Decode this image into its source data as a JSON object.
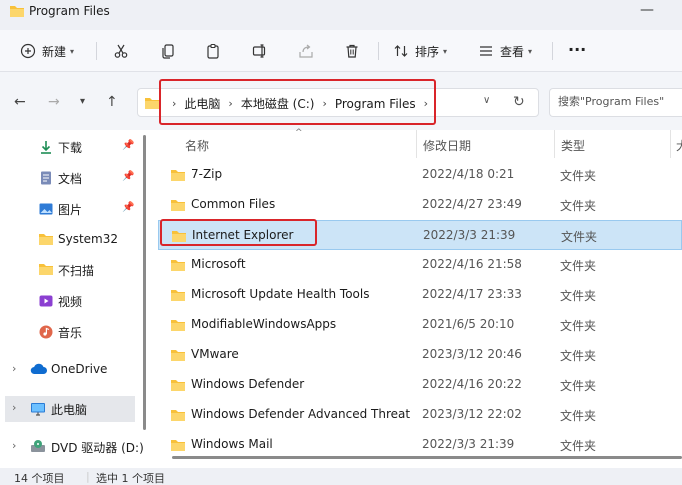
{
  "window": {
    "title": "Program Files"
  },
  "toolbar": {
    "new_label": "新建",
    "sort_label": "排序",
    "view_label": "查看",
    "more": "···"
  },
  "address": {
    "crumbs": [
      "此电脑",
      "本地磁盘 (C:)",
      "Program Files"
    ],
    "search_placeholder": "搜索\"Program Files\""
  },
  "sidebar": {
    "items": [
      {
        "label": "下载",
        "icon": "download-icon"
      },
      {
        "label": "文档",
        "icon": "document-icon"
      },
      {
        "label": "图片",
        "icon": "pictures-icon"
      },
      {
        "label": "System32",
        "icon": "folder-icon"
      },
      {
        "label": "不扫描",
        "icon": "folder-icon"
      },
      {
        "label": "视频",
        "icon": "video-icon"
      },
      {
        "label": "音乐",
        "icon": "music-icon"
      },
      {
        "label": "OneDrive",
        "icon": "cloud-icon"
      },
      {
        "label": "此电脑",
        "icon": "monitor-icon"
      },
      {
        "label": "DVD 驱动器 (D:)",
        "icon": "dvd-icon"
      }
    ]
  },
  "columns": {
    "name": "名称",
    "date": "修改日期",
    "type": "类型",
    "size": "大"
  },
  "files": [
    {
      "name": "7-Zip",
      "date": "2022/4/18 0:21",
      "type": "文件夹"
    },
    {
      "name": "Common Files",
      "date": "2022/4/27 23:49",
      "type": "文件夹"
    },
    {
      "name": "Internet Explorer",
      "date": "2022/3/3 21:39",
      "type": "文件夹"
    },
    {
      "name": "Microsoft",
      "date": "2022/4/16 21:58",
      "type": "文件夹"
    },
    {
      "name": "Microsoft Update Health Tools",
      "date": "2022/4/17 23:33",
      "type": "文件夹"
    },
    {
      "name": "ModifiableWindowsApps",
      "date": "2021/6/5 20:10",
      "type": "文件夹"
    },
    {
      "name": "VMware",
      "date": "2023/3/12 20:46",
      "type": "文件夹"
    },
    {
      "name": "Windows Defender",
      "date": "2022/4/16 20:22",
      "type": "文件夹"
    },
    {
      "name": "Windows Defender Advanced Threat ...",
      "date": "2023/3/12 22:02",
      "type": "文件夹"
    },
    {
      "name": "Windows Mail",
      "date": "2022/3/3 21:39",
      "type": "文件夹"
    }
  ],
  "status": {
    "count": "14 个项目",
    "selected": "选中 1 个项目"
  },
  "colors": {
    "folder": "#f8c13a",
    "selection": "#cce4f7",
    "highlight": "#d9252a"
  }
}
